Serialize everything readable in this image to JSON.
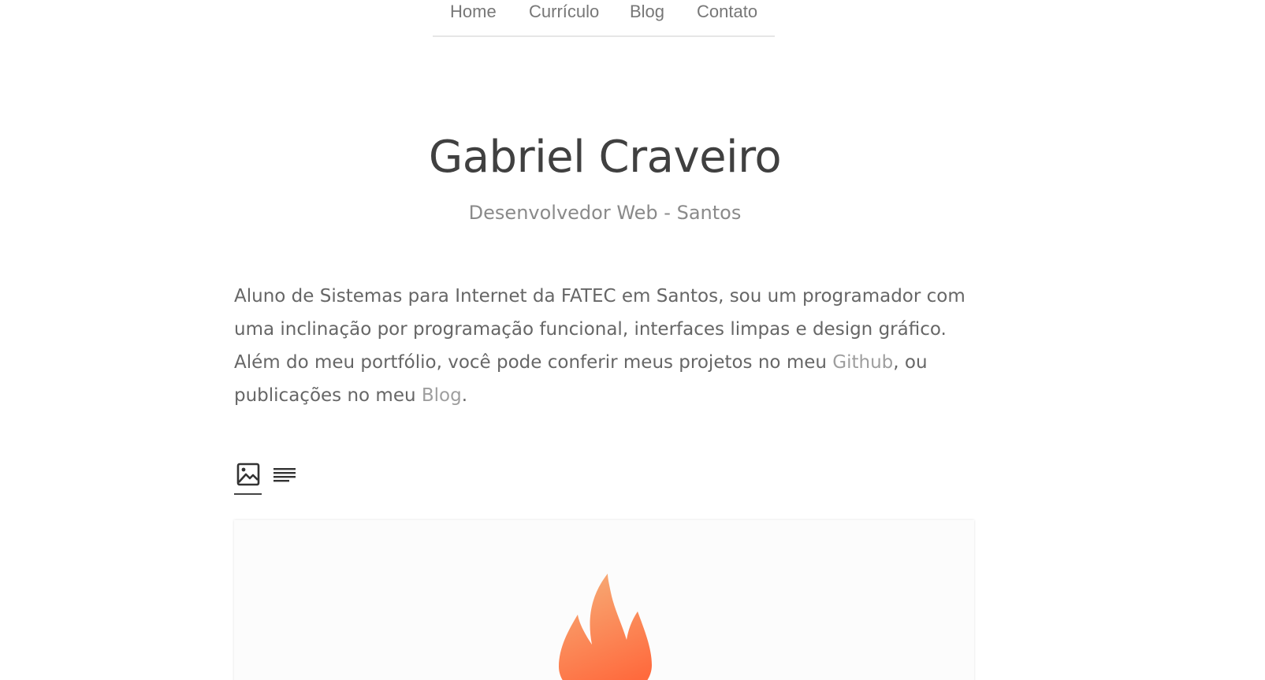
{
  "nav": {
    "items": [
      {
        "label": "Home"
      },
      {
        "label": "Currículo"
      },
      {
        "label": "Blog"
      },
      {
        "label": "Contato"
      }
    ]
  },
  "hero": {
    "title": "Gabriel Craveiro",
    "subtitle": "Desenvolvedor Web - Santos"
  },
  "bio": {
    "text_1": "Aluno de Sistemas para Internet da FATEC em Santos, sou um programador com uma inclinação por programação funcional, interfaces limpas e design gráfico. Além do meu portfólio, você pode conferir meus projetos no meu ",
    "link_github": "Github",
    "text_2": ", ou publicações no meu ",
    "link_blog": "Blog",
    "text_3": "."
  },
  "view_toggle": {
    "options": [
      {
        "icon": "image-icon",
        "active": true
      },
      {
        "icon": "text-lines-icon",
        "active": false
      }
    ]
  },
  "card": {
    "icon": "flame-icon",
    "accent_colors": [
      "#f6b07a",
      "#ff6a3d"
    ]
  }
}
